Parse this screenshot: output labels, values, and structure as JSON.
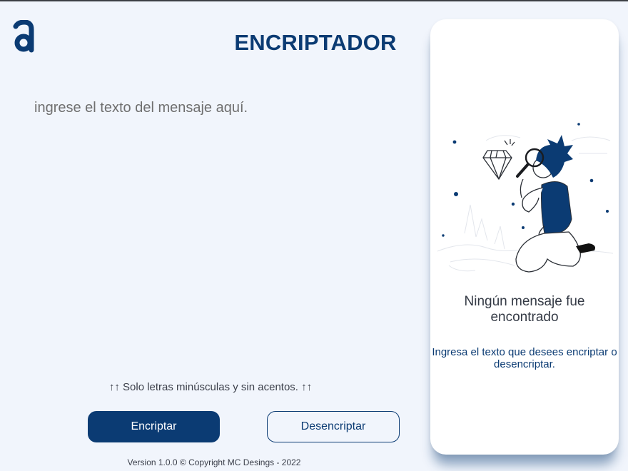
{
  "app": {
    "logo_icon": "letter-a-logo",
    "title": "ENCRIPTADOR"
  },
  "editor": {
    "placeholder": "ingrese el texto del mensaje aquí.",
    "value": ""
  },
  "hint": {
    "text": "↑↑ Solo letras minúsculas y sin acentos. ↑↑"
  },
  "actions": {
    "encrypt_label": "Encriptar",
    "decrypt_label": "Desencriptar"
  },
  "footer": {
    "text": "Version 1.0.0 © Copyright MC Desings - 2022"
  },
  "result_panel": {
    "illustration_icon": "person-with-magnifying-glass-illustration",
    "heading": "Ningún mensaje fue encontrado",
    "text": "Ingresa el texto que desees encriptar o desencriptar."
  },
  "colors": {
    "background": "#f1f5fc",
    "primary": "#0b3b73",
    "panel": "#ffffff",
    "text_muted": "#6f6f6f"
  }
}
